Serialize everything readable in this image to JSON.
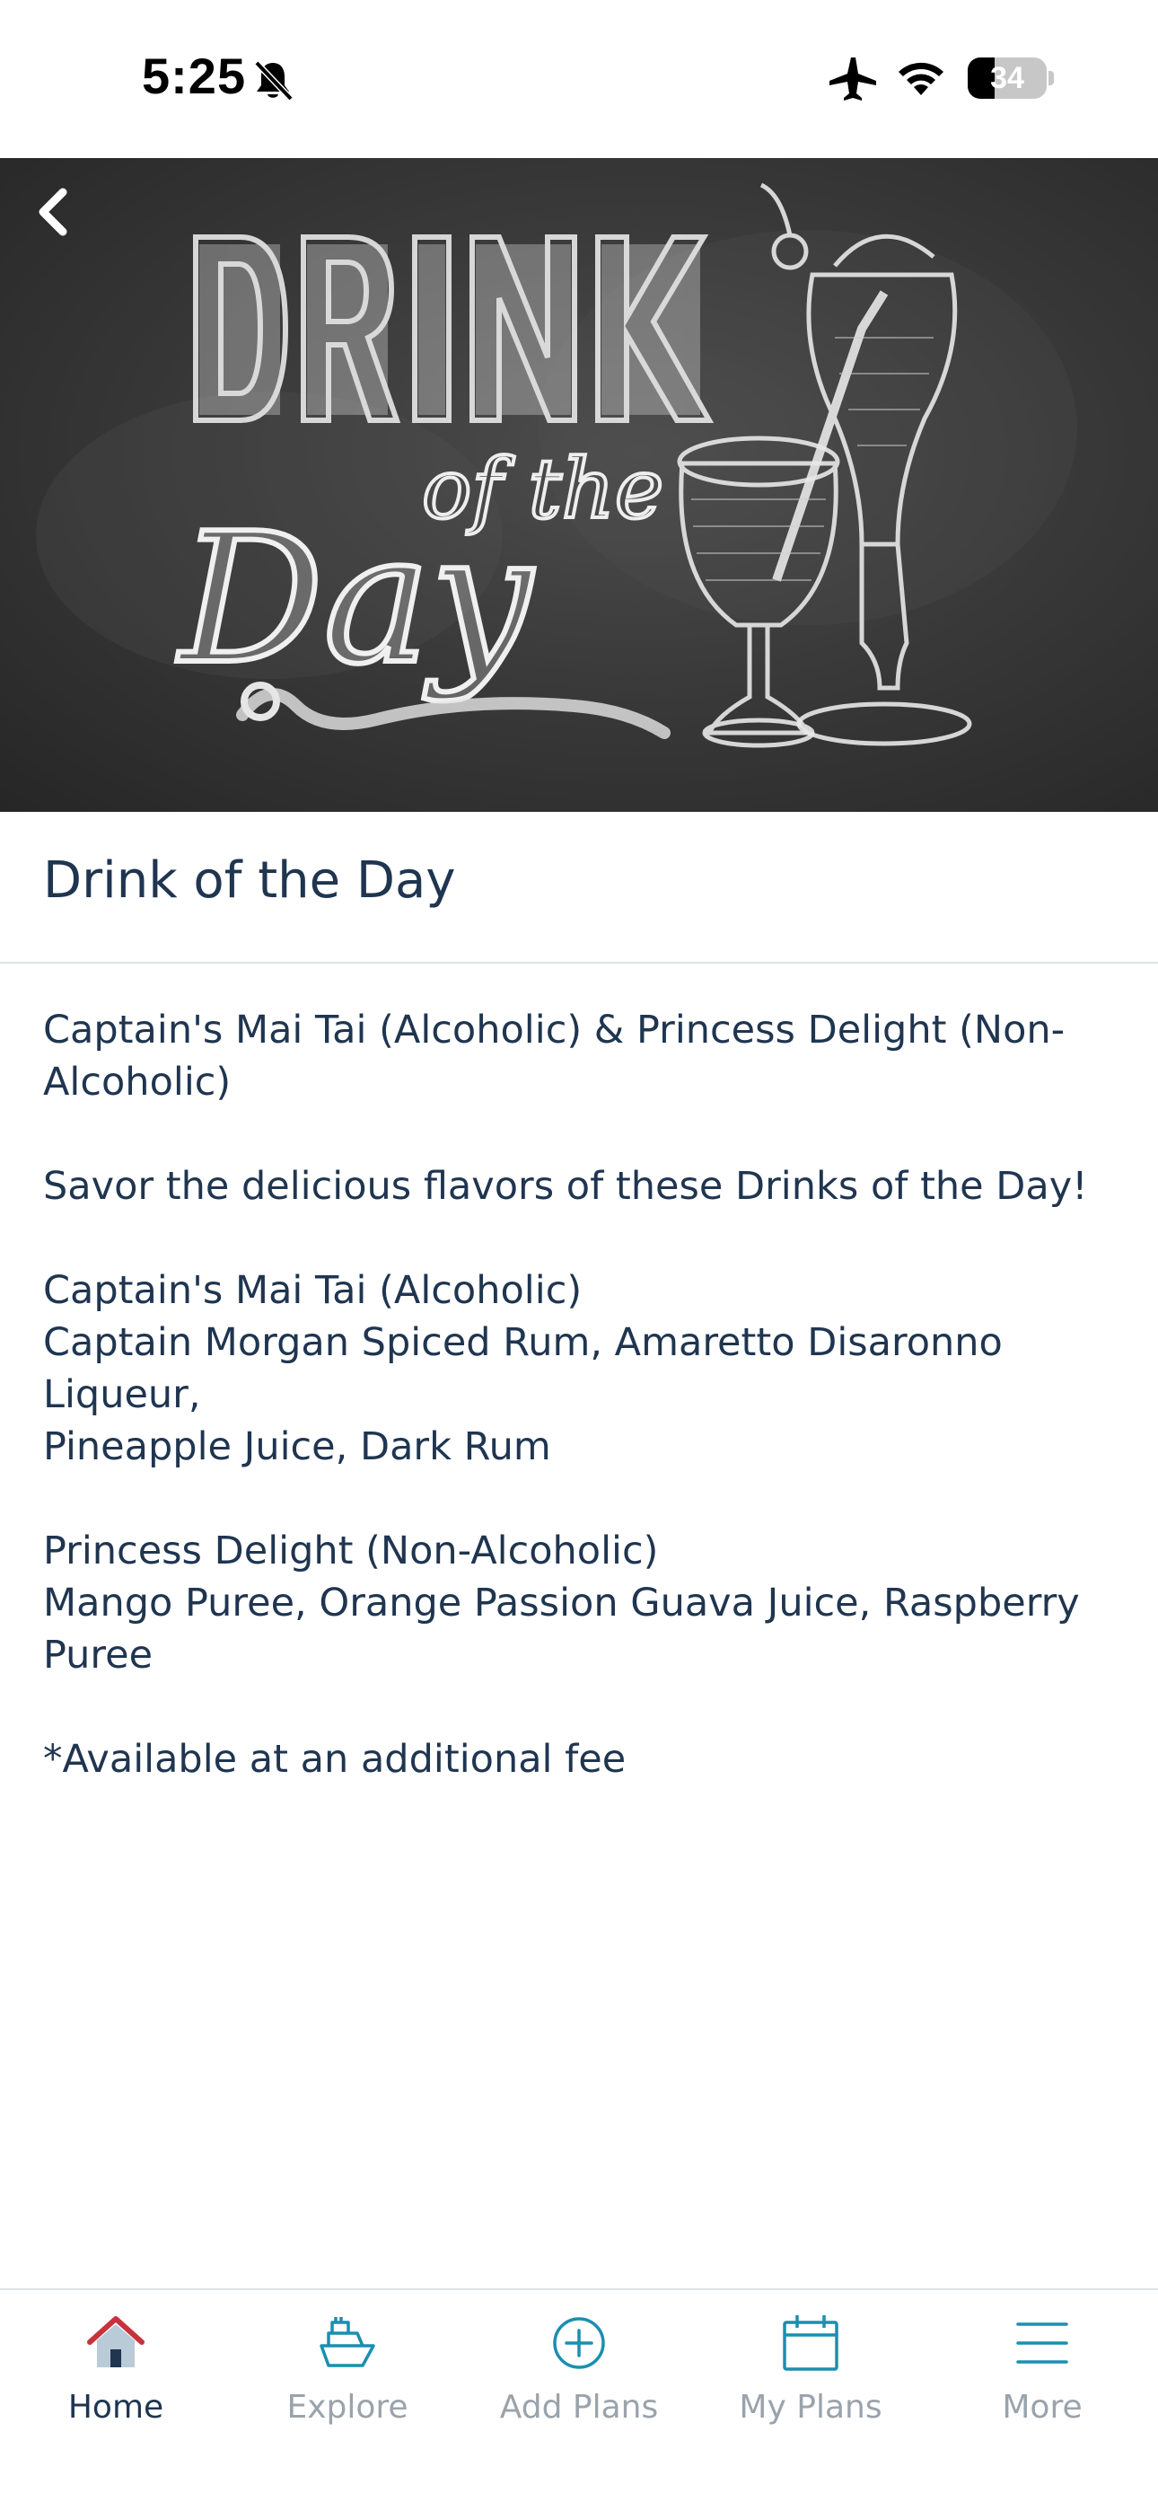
{
  "status_bar": {
    "time": "5:25",
    "battery": "34",
    "battery_level": 0.34
  },
  "header": {
    "back_icon": "chevron-left-icon"
  },
  "hero": {
    "alt_image": "drink-of-the-day-chalkboard"
  },
  "page": {
    "title": "Drink of the Day",
    "intro_line_1": "Captain's Mai Tai (Alcoholic) & Princess Delight (Non-",
    "intro_line_2": "Alcoholic)",
    "tagline": "Savor the delicious flavors of these Drinks of the Day!",
    "drink1_name": "Captain's Mai Tai (Alcoholic)",
    "drink1_ing_1": "Captain Morgan Spiced Rum, Amaretto Disaronno Liqueur,",
    "drink1_ing_2": "Pineapple Juice, Dark Rum",
    "drink2_name": "Princess Delight (Non-Alcoholic)",
    "drink2_ing": "Mango Puree, Orange Passion Guava Juice, Raspberry Puree",
    "fee_note": "*Available at an additional fee"
  },
  "tabs": [
    {
      "label": "Home",
      "icon": "home-icon",
      "active": true
    },
    {
      "label": "Explore",
      "icon": "ship-icon",
      "active": false
    },
    {
      "label": "Add Plans",
      "icon": "plus-circle-icon",
      "active": false
    },
    {
      "label": "My Plans",
      "icon": "calendar-icon",
      "active": false
    },
    {
      "label": "More",
      "icon": "menu-icon",
      "active": false
    }
  ],
  "colors": {
    "text_primary": "#1f3550",
    "tab_inactive": "#9aa3ab",
    "tab_icon_teal": "#1a8fb0",
    "home_roof_red": "#c8323c"
  }
}
